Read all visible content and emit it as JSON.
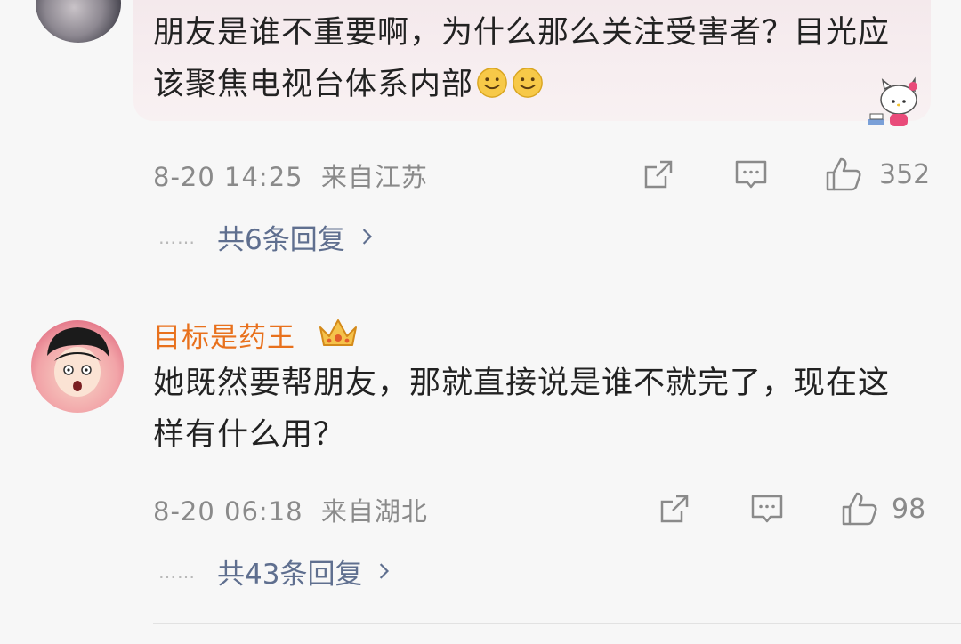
{
  "comments": [
    {
      "text": "朋友是谁不重要啊，为什么那么关注受害者？目光应该聚焦电视台体系内部",
      "emoji_icon": "smiley-icon",
      "timestamp": "8-20 14:25",
      "location": "来自江苏",
      "like_count": "352",
      "reply_label": "共6条回复",
      "reply_dots": "……"
    },
    {
      "username": "目标是药王",
      "badge_icon": "crown-icon",
      "text": "她既然要帮朋友，那就直接说是谁不就完了，现在这样有什么用？",
      "timestamp": "8-20 06:18",
      "location": "来自湖北",
      "like_count": "98",
      "reply_label": "共43条回复",
      "reply_dots": "……"
    }
  ],
  "colors": {
    "username": "#e8711d",
    "reply_link": "#5f6f8f",
    "meta": "#8a8a8a"
  }
}
